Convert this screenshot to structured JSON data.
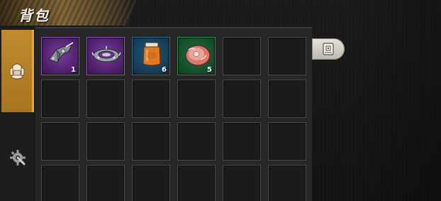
{
  "header": {
    "title": "背包"
  },
  "tabs": [
    {
      "name": "backpack",
      "icon": "backpack-icon",
      "active": true
    },
    {
      "name": "crafting",
      "icon": "gear-wrench-icon",
      "active": false
    }
  ],
  "inventory": {
    "columns": 6,
    "visible_rows": 4,
    "items": [
      {
        "slot": 1,
        "icon": "mechanical-part-icon",
        "rarity": "purple",
        "count": "1"
      },
      {
        "slot": 2,
        "icon": "metal-frame-icon",
        "rarity": "purple",
        "count": ""
      },
      {
        "slot": 3,
        "icon": "jam-jar-icon",
        "rarity": "blue",
        "count": "6"
      },
      {
        "slot": 4,
        "icon": "ham-meat-icon",
        "rarity": "green",
        "count": "5"
      }
    ]
  },
  "side_button": {
    "icon": "storage-box-icon"
  },
  "colors": {
    "accent": "#c08a2e",
    "rarity_purple": "#52236f",
    "rarity_blue": "#163f57",
    "rarity_green": "#15502d",
    "panel_bg": "#262626"
  }
}
